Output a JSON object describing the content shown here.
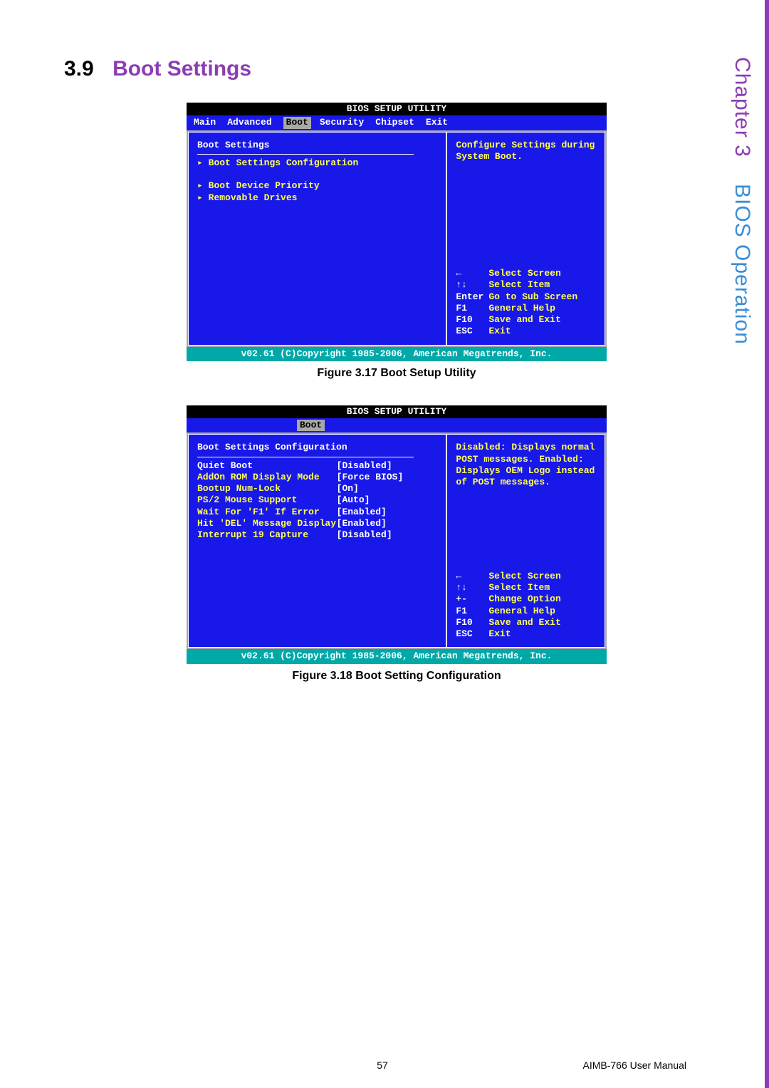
{
  "heading": {
    "num": "3.9",
    "title": "Boot Settings"
  },
  "side": {
    "chapter": "Chapter 3",
    "section": "BIOS Operation"
  },
  "bios1": {
    "title": "BIOS SETUP UTILITY",
    "tabs": {
      "main": "Main",
      "advanced": "Advanced",
      "boot": "Boot",
      "security": "Security",
      "chipset": "Chipset",
      "exit": "Exit"
    },
    "section": "Boot Settings",
    "items": [
      "Boot Settings Configuration",
      "Boot Device Priority",
      "Removable Drives"
    ],
    "help": "Configure Settings during System Boot.",
    "keys": [
      {
        "k": "←",
        "a": "Select Screen"
      },
      {
        "k": "↑↓",
        "a": "Select Item"
      },
      {
        "k": "Enter",
        "a": "Go to Sub Screen"
      },
      {
        "k": "F1",
        "a": "General Help"
      },
      {
        "k": "F10",
        "a": "Save and Exit"
      },
      {
        "k": "ESC",
        "a": "Exit"
      }
    ],
    "footer": "v02.61 (C)Copyright 1985-2006, American Megatrends, Inc."
  },
  "caption1": "Figure 3.17 Boot Setup Utility",
  "bios2": {
    "title": "BIOS SETUP UTILITY",
    "boot_tab": "Boot",
    "section": "Boot Settings Configuration",
    "rows": [
      {
        "lbl": "Quiet Boot",
        "val": "[Disabled]",
        "sel": true
      },
      {
        "lbl": "AddOn ROM Display Mode",
        "val": "[Force BIOS]"
      },
      {
        "lbl": "Bootup Num-Lock",
        "val": "[On]"
      },
      {
        "lbl": "PS/2 Mouse Support",
        "val": "[Auto]"
      },
      {
        "lbl": "Wait For 'F1' If Error",
        "val": "[Enabled]"
      },
      {
        "lbl": "Hit 'DEL' Message Display",
        "val": "[Enabled]"
      },
      {
        "lbl": "Interrupt 19 Capture",
        "val": "[Disabled]"
      }
    ],
    "help": "Disabled: Displays normal POST messages. Enabled: Displays OEM Logo instead of POST messages.",
    "keys": [
      {
        "k": "←",
        "a": "Select Screen"
      },
      {
        "k": "↑↓",
        "a": "Select Item"
      },
      {
        "k": "+-",
        "a": "Change Option"
      },
      {
        "k": "F1",
        "a": "General Help"
      },
      {
        "k": "F10",
        "a": "Save and Exit"
      },
      {
        "k": "ESC",
        "a": "Exit"
      }
    ],
    "footer": "v02.61 (C)Copyright 1985-2006, American Megatrends, Inc."
  },
  "caption2": "Figure 3.18 Boot Setting Configuration",
  "footer": {
    "page": "57",
    "manual": "AIMB-766 User Manual"
  }
}
